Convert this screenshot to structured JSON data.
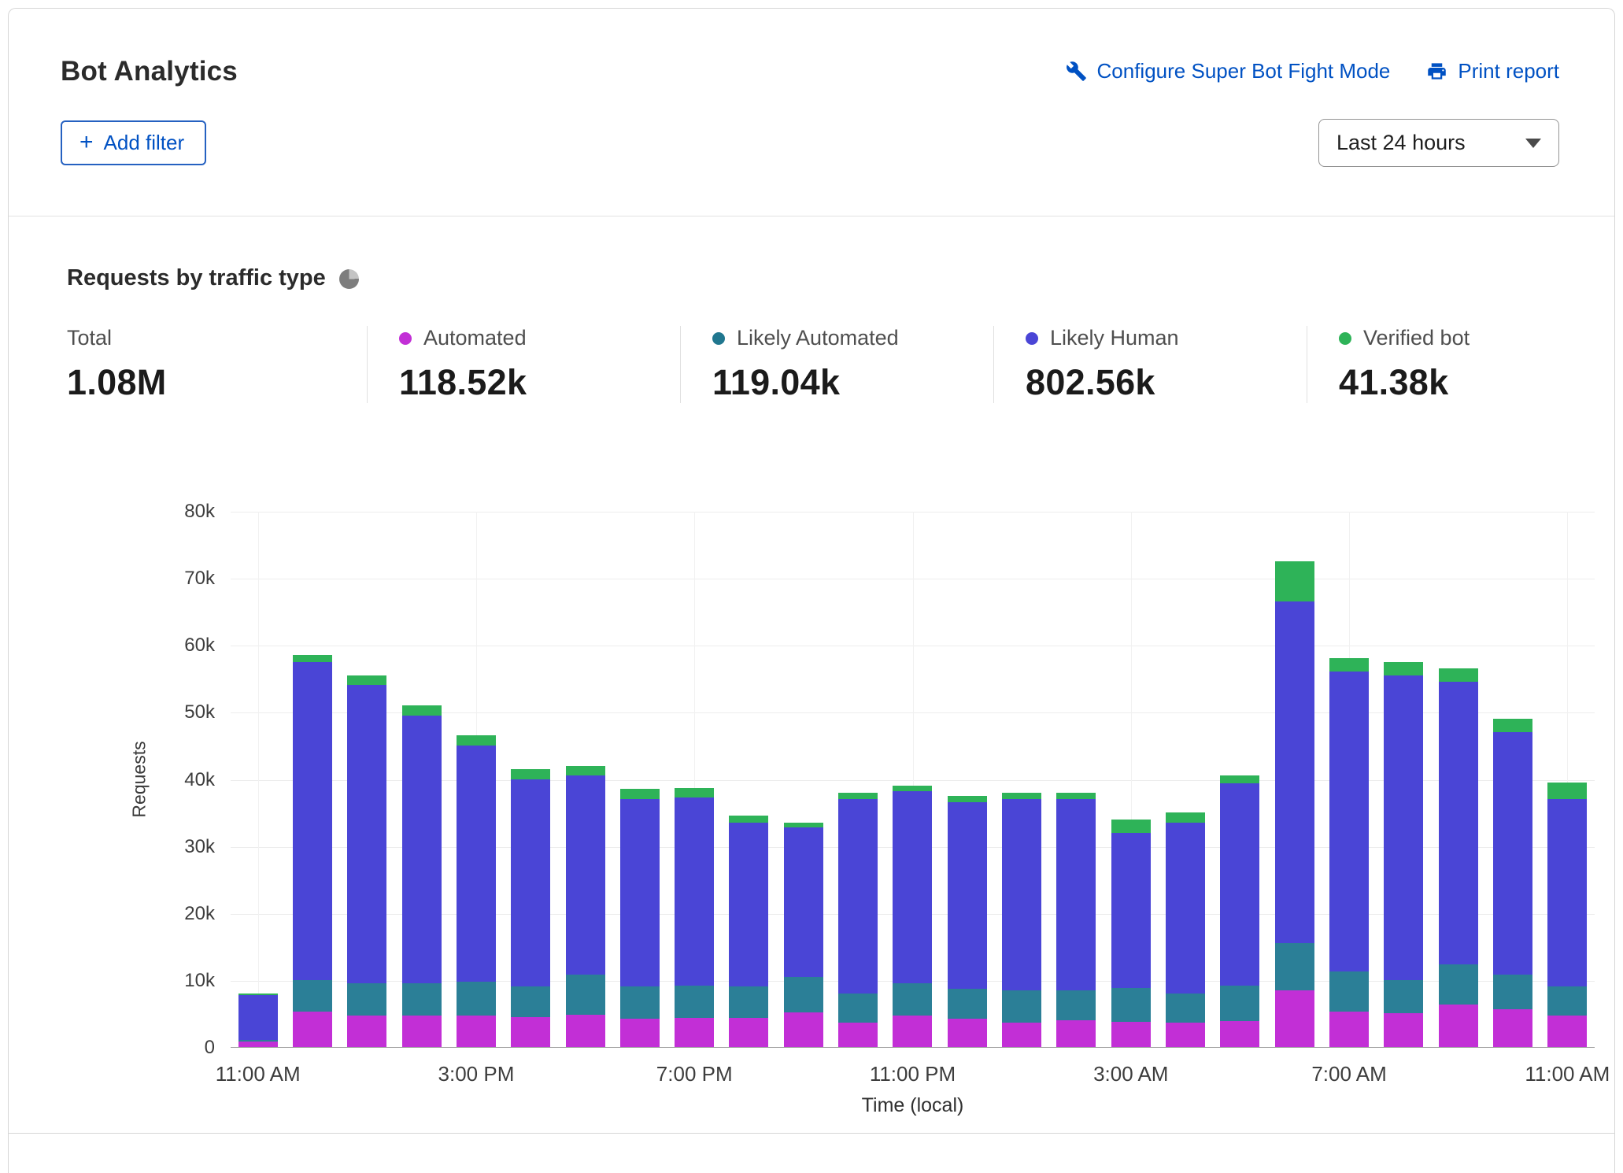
{
  "header": {
    "title": "Bot Analytics",
    "configure_link": "Configure Super Bot Fight Mode",
    "print_link": "Print report",
    "add_filter_label": "Add filter",
    "time_range": "Last 24 hours"
  },
  "section": {
    "title": "Requests by traffic type"
  },
  "colors": {
    "link_blue": "#0051c3",
    "automated": "#c22fd6",
    "likely_automated": "#20778f",
    "likely_human": "#4a45d6",
    "verified_bot": "#2eb358"
  },
  "stats": [
    {
      "label": "Total",
      "value": "1.08M",
      "color": null
    },
    {
      "label": "Automated",
      "value": "118.52k",
      "color": "#c22fd6"
    },
    {
      "label": "Likely Automated",
      "value": "119.04k",
      "color": "#20778f"
    },
    {
      "label": "Likely Human",
      "value": "802.56k",
      "color": "#4a45d6"
    },
    {
      "label": "Verified bot",
      "value": "41.38k",
      "color": "#2eb358"
    }
  ],
  "chart_data": {
    "type": "bar",
    "stacked": true,
    "title": "Requests by traffic type",
    "xlabel": "Time (local)",
    "ylabel": "Requests",
    "ylim": [
      0,
      80000
    ],
    "grid": true,
    "legend_position": "top",
    "yticks": [
      "0",
      "10k",
      "20k",
      "30k",
      "40k",
      "50k",
      "60k",
      "70k",
      "80k"
    ],
    "xticks": [
      {
        "label": "11:00 AM",
        "index": 0
      },
      {
        "label": "3:00 PM",
        "index": 4
      },
      {
        "label": "7:00 PM",
        "index": 8
      },
      {
        "label": "11:00 PM",
        "index": 12
      },
      {
        "label": "3:00 AM",
        "index": 16
      },
      {
        "label": "7:00 AM",
        "index": 20
      },
      {
        "label": "11:00 AM",
        "index": 24
      }
    ],
    "series": [
      {
        "name": "Automated",
        "color": "#c22fd6",
        "values": [
          800,
          5300,
          4700,
          4700,
          4700,
          4500,
          4800,
          4200,
          4400,
          4300,
          5200,
          3600,
          4700,
          4200,
          3600,
          4000,
          3800,
          3600,
          3900,
          8500,
          5300,
          5000,
          6300,
          5600,
          4700
        ]
      },
      {
        "name": "Likely Automated",
        "color": "#2b7f97",
        "values": [
          300,
          4700,
          4800,
          4800,
          5000,
          4500,
          6000,
          4800,
          4800,
          4700,
          5300,
          4400,
          4800,
          4500,
          4900,
          4500,
          5000,
          4400,
          5300,
          7000,
          6000,
          5000,
          6000,
          5200,
          4300
        ]
      },
      {
        "name": "Likely Human",
        "color": "#4a45d6",
        "values": [
          6700,
          47500,
          44500,
          40000,
          35300,
          31000,
          29700,
          28000,
          28000,
          24500,
          22300,
          29000,
          28700,
          27800,
          28500,
          28500,
          23200,
          25500,
          30100,
          51000,
          44700,
          45500,
          42200,
          36200,
          28000
        ]
      },
      {
        "name": "Verified bot",
        "color": "#2eb358",
        "values": [
          200,
          1000,
          1500,
          1500,
          1500,
          1500,
          1500,
          1500,
          1500,
          1000,
          700,
          1000,
          800,
          1000,
          1000,
          1000,
          2000,
          1500,
          1200,
          6000,
          2000,
          2000,
          2000,
          2000,
          2500
        ]
      }
    ]
  }
}
